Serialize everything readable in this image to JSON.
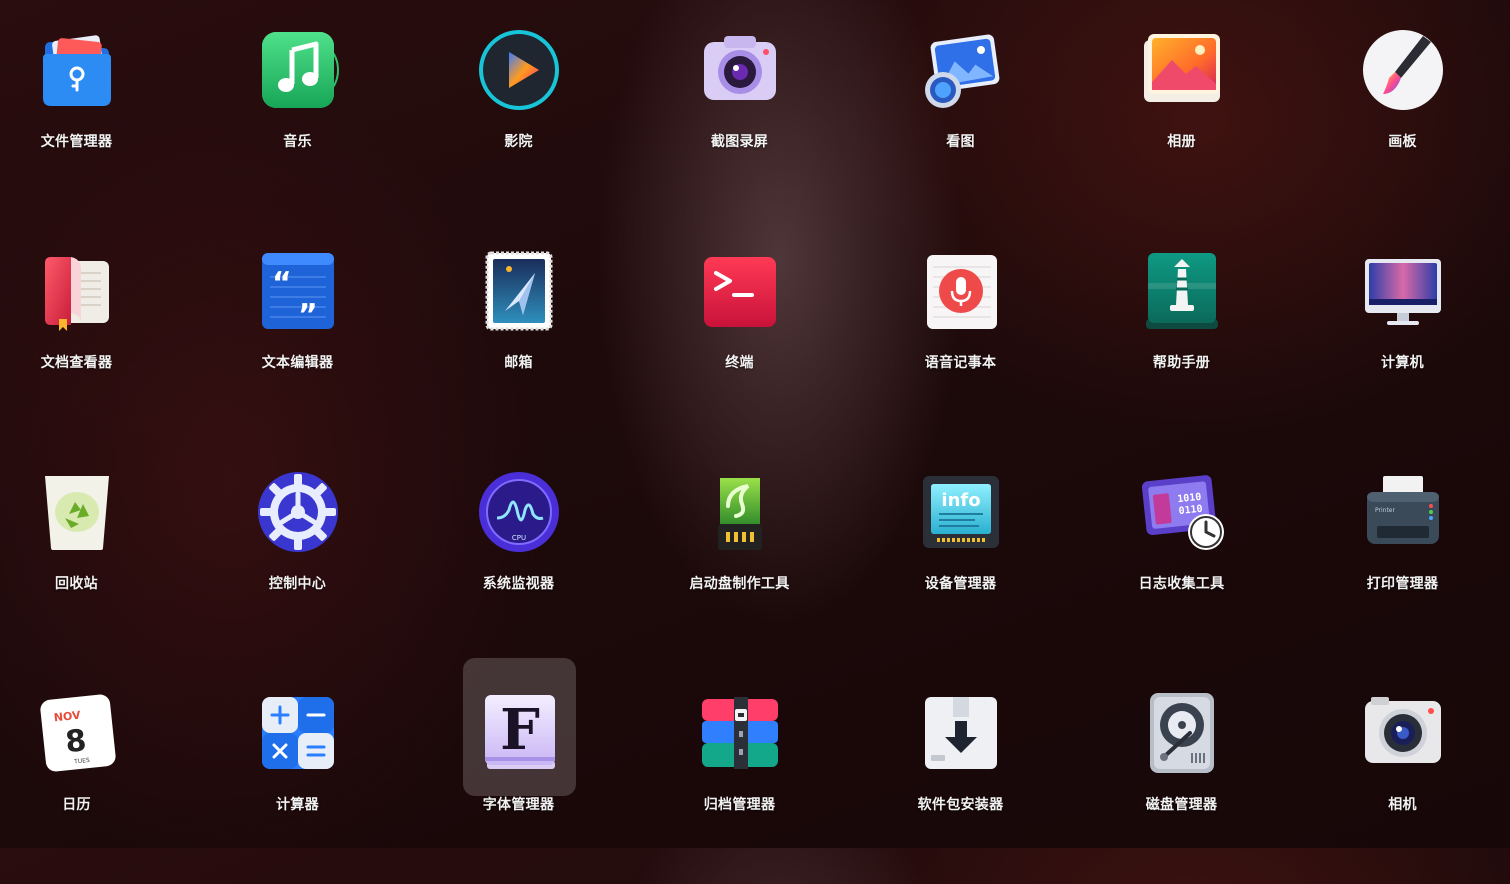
{
  "apps": [
    {
      "label": "文件管理器",
      "icon": "file-manager-icon"
    },
    {
      "label": "音乐",
      "icon": "music-icon"
    },
    {
      "label": "影院",
      "icon": "movie-icon"
    },
    {
      "label": "截图录屏",
      "icon": "screenshot-camera-icon"
    },
    {
      "label": "看图",
      "icon": "image-viewer-icon"
    },
    {
      "label": "相册",
      "icon": "album-icon"
    },
    {
      "label": "画板",
      "icon": "draw-brush-icon"
    },
    {
      "label": "文档查看器",
      "icon": "document-viewer-icon"
    },
    {
      "label": "文本编辑器",
      "icon": "text-editor-icon"
    },
    {
      "label": "邮箱",
      "icon": "mail-icon"
    },
    {
      "label": "终端",
      "icon": "terminal-icon"
    },
    {
      "label": "语音记事本",
      "icon": "voice-notes-icon"
    },
    {
      "label": "帮助手册",
      "icon": "help-manual-icon"
    },
    {
      "label": "计算机",
      "icon": "computer-monitor-icon"
    },
    {
      "label": "回收站",
      "icon": "trash-recycle-icon"
    },
    {
      "label": "控制中心",
      "icon": "control-center-gear-icon"
    },
    {
      "label": "系统监视器",
      "icon": "system-monitor-icon"
    },
    {
      "label": "启动盘制作工具",
      "icon": "boot-maker-usb-icon"
    },
    {
      "label": "设备管理器",
      "icon": "device-manager-info-icon"
    },
    {
      "label": "日志收集工具",
      "icon": "log-collector-icon"
    },
    {
      "label": "打印管理器",
      "icon": "printer-icon"
    },
    {
      "label": "日历",
      "icon": "calendar-icon",
      "month": "NOV",
      "day": "8",
      "weekday": "TUES"
    },
    {
      "label": "计算器",
      "icon": "calculator-icon"
    },
    {
      "label": "字体管理器",
      "icon": "font-manager-icon",
      "glyph": "F"
    },
    {
      "label": "归档管理器",
      "icon": "archive-manager-icon"
    },
    {
      "label": "软件包安装器",
      "icon": "package-installer-icon"
    },
    {
      "label": "磁盘管理器",
      "icon": "disk-manager-icon"
    },
    {
      "label": "相机",
      "icon": "camera-icon"
    }
  ],
  "selected_index": 23,
  "colors": {
    "label": "#f2f2f2",
    "selection": "rgba(255,255,255,0.18)"
  }
}
